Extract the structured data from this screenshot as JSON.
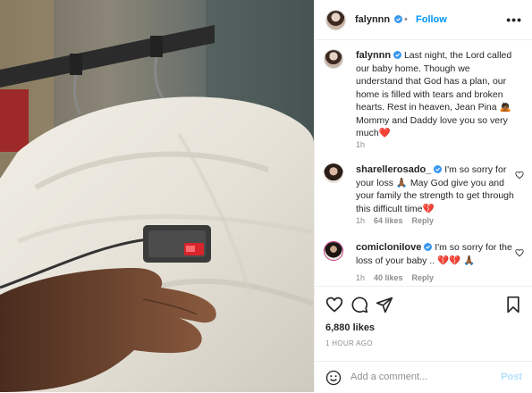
{
  "post": {
    "author": "falynnn",
    "follow_label": "Follow",
    "separator": "•",
    "more_label": "•••",
    "caption": {
      "username": "falynnn",
      "text": "Last night, the Lord called our baby home. Though we understand that God has a plan, our home is filled with tears and broken hearts. Rest in heaven, Jean Pina 🙇🏾 Mommy and Daddy love you so very much❤️",
      "age": "1h"
    },
    "comments": [
      {
        "username": "sharellerosado_",
        "text": "I'm so sorry for your loss 🙏🏾 May God give you and your family the strength to get through this difficult time💔",
        "age": "1h",
        "likes": "64 likes",
        "reply": "Reply"
      },
      {
        "username": "comicloniIove",
        "text": "I'm so sorry for the loss of your baby .. 💔💔 🙏🏾",
        "age": "1h",
        "likes": "40 likes",
        "reply": "Reply"
      }
    ],
    "likes_count": "6,880 likes",
    "timestamp": "1 HOUR AGO",
    "comment_placeholder": "Add a comment...",
    "post_button": "Post"
  },
  "icons": [
    "verified-icon",
    "more-icon",
    "heart-icon",
    "comment-icon",
    "share-icon",
    "bookmark-icon",
    "emoji-icon"
  ],
  "colors": {
    "link": "#0095f6",
    "verified": "#3897f0",
    "muted": "#8e8e8e",
    "post_disabled": "#b2dffc"
  }
}
